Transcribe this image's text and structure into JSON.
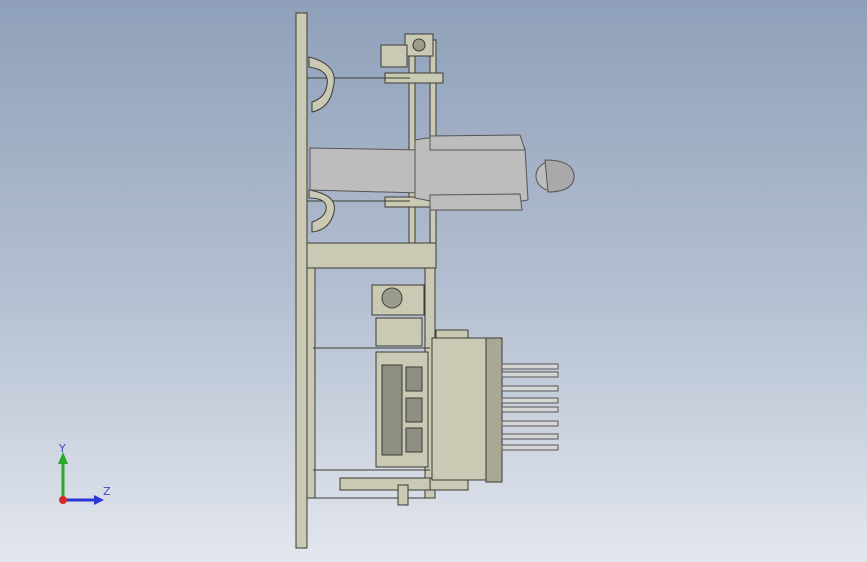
{
  "viewport": {
    "background_top": "#8fa0ba",
    "background_bottom": "#e3e7ee",
    "model_fill": "#c9c9b4",
    "model_stroke": "#3c3c34",
    "figure_fill": "#b9b9b9"
  },
  "triad": {
    "y_label": "Y",
    "z_label": "Z",
    "y_color": "#2ca82c",
    "z_color": "#2a37d6",
    "x_color": "#d62a2a"
  }
}
